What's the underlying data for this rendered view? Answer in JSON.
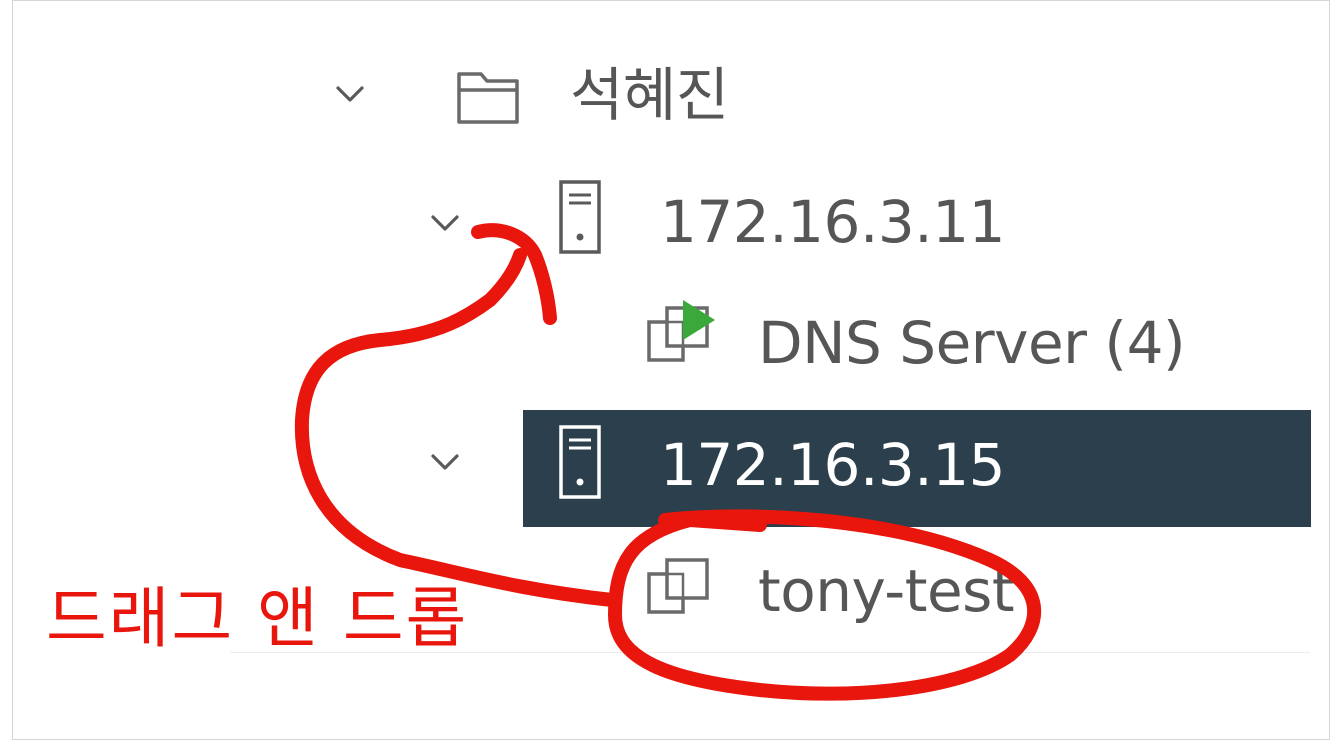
{
  "tree": {
    "folder": {
      "label": "석혜진",
      "icon": "folder-icon",
      "expanded": true
    },
    "hosts": [
      {
        "label": "172.16.3.11",
        "icon": "server-icon",
        "expanded": true,
        "selected": false,
        "children": [
          {
            "label": "DNS Server (4)",
            "icon": "vm-powered-on-icon"
          }
        ]
      },
      {
        "label": "172.16.3.15",
        "icon": "server-icon",
        "expanded": true,
        "selected": true,
        "children": [
          {
            "label": "tony-test",
            "icon": "vm-icon"
          }
        ]
      }
    ]
  },
  "annotation": {
    "text": "드래그 앤 드롭",
    "color": "#e8160c"
  },
  "colors": {
    "selected_row": "#2b3f4c",
    "text": "#565656",
    "power_on": "#3aa83a"
  }
}
